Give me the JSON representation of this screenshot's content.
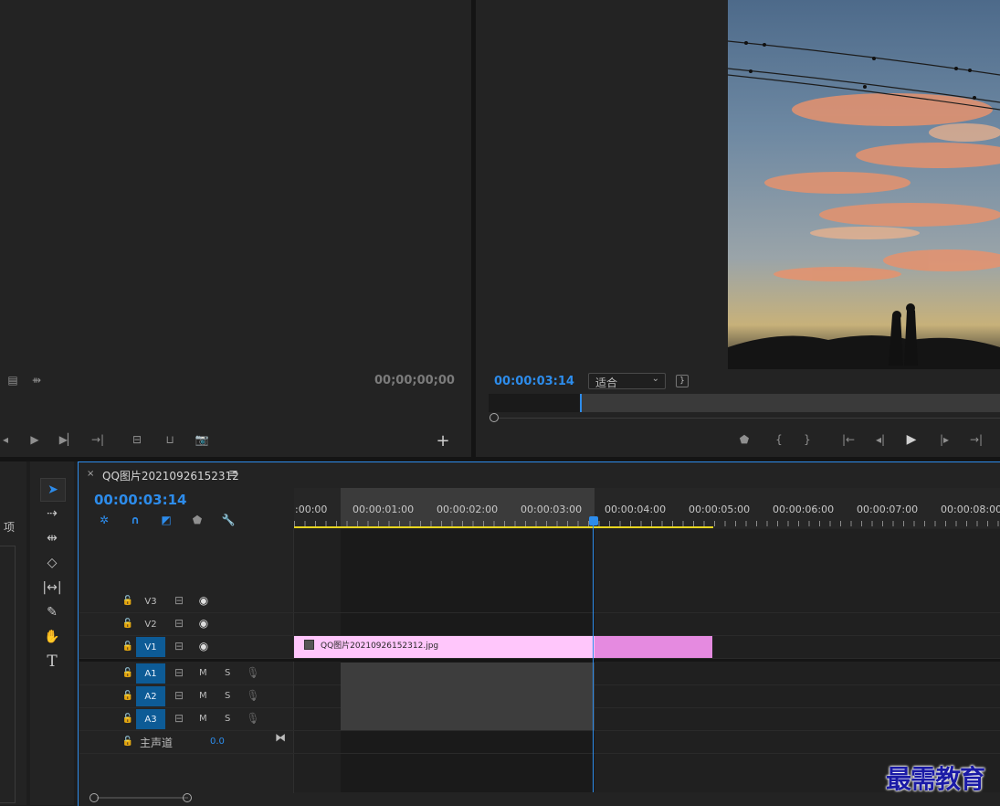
{
  "source_monitor": {
    "timecode": "00;00;00;00",
    "side_label": "项"
  },
  "program_monitor": {
    "timecode": "00:00:03:14",
    "fit_label": "适合"
  },
  "timeline": {
    "sequence_name": "QQ图片20210926152312",
    "timecode": "00:00:03:14",
    "ruler": [
      ":00:00",
      "00:00:01:00",
      "00:00:02:00",
      "00:00:03:00",
      "00:00:04:00",
      "00:00:05:00",
      "00:00:06:00",
      "00:00:07:00",
      "00:00:08:00"
    ],
    "video_tracks": [
      "V3",
      "V2",
      "V1"
    ],
    "audio_tracks": [
      "A1",
      "A2",
      "A3"
    ],
    "audio_mute": "M",
    "audio_solo": "S",
    "master_label": "主声道",
    "master_value": "0.0",
    "clip_name": "QQ图片20210926152312.jpg",
    "playhead_fraction": 0.356
  },
  "watermark": "最需教育",
  "colors": {
    "accent": "#2d8ceb",
    "clip": "#ffc6fb",
    "clip_dark": "#e58ae0",
    "work_area": "#e8d51e"
  }
}
